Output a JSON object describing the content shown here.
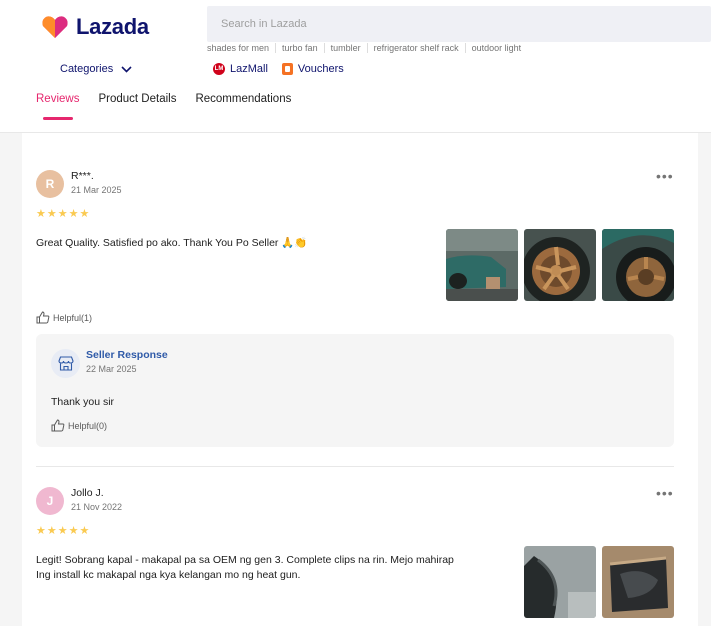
{
  "header": {
    "logo_text": "Lazada",
    "search_placeholder": "Search in Lazada",
    "suggestions": [
      "shades for men",
      "turbo fan",
      "tumbler",
      "refrigerator shelf rack",
      "outdoor light"
    ],
    "categories_label": "Categories",
    "lazmall_label": "LazMall",
    "lazmall_badge": "LM",
    "vouchers_label": "Vouchers"
  },
  "tabs": [
    {
      "label": "Reviews",
      "active": true
    },
    {
      "label": "Product Details",
      "active": false
    },
    {
      "label": "Recommendations",
      "active": false
    }
  ],
  "reviews": [
    {
      "initial": "R",
      "avatar_color": "#e8c0a0",
      "name": "R***.",
      "date": "21 Mar 2025",
      "stars": 5,
      "text": "Great Quality. Satisfied po ako. Thank You Po Seller 🙏👏",
      "helpful": "Helpful(1)",
      "images": [
        "garage-car-photo",
        "bronze-wheel-photo",
        "wheel-arch-photo"
      ],
      "seller_response": {
        "title": "Seller Response",
        "date": "22 Mar 2025",
        "text": "Thank you sir",
        "helpful": "Helpful(0)"
      }
    },
    {
      "initial": "J",
      "avatar_color": "#f0b8d0",
      "name": "Jollo J.",
      "date": "21 Nov 2022",
      "stars": 5,
      "text_line1": "Legit! Sobrang kapal - makapal pa sa OEM ng gen 3. Complete clips na rin. Mejo mahirap",
      "text_line2": "Ing install kc makapal nga kya kelangan mo ng heat gun.",
      "images": [
        "fender-liner-photo",
        "package-box-photo"
      ]
    }
  ],
  "more_label": "•••",
  "colors": {
    "accent": "#e6276e",
    "brand_navy": "#0f146d",
    "star": "#faca51",
    "seller_blue": "#2f5aa8"
  }
}
